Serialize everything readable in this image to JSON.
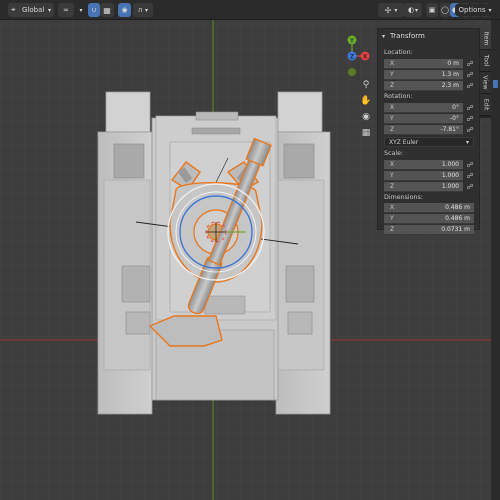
{
  "header": {
    "orientation_label": "Global",
    "options_label": "Options"
  },
  "npanel": {
    "section_title": "Transform",
    "location": {
      "label": "Location:",
      "x": "0 m",
      "y": "1.3 m",
      "z": "2.3 m"
    },
    "rotation": {
      "label": "Rotation:",
      "x": "0°",
      "y": "-0°",
      "z": "-7.81°"
    },
    "rotation_mode": "XYZ Euler",
    "scale": {
      "label": "Scale:",
      "x": "1.000",
      "y": "1.000",
      "z": "1.000"
    },
    "dimensions": {
      "label": "Dimensions:",
      "x": "0.486 m",
      "y": "0.486 m",
      "z": "0.0731 m"
    },
    "axis_labels": {
      "x": "X",
      "y": "Y",
      "z": "Z"
    }
  },
  "side_tabs": [
    "Item",
    "Tool",
    "View",
    "Edit"
  ],
  "gizmo": {
    "x": "X",
    "y": "Y",
    "z": "Z"
  },
  "colors": {
    "selection_outline": "#e8771d",
    "x_axis_line": "#9a3535",
    "y_axis_line": "#5f8a22",
    "accent": "#4772b3",
    "gizmo_x": "#d9423f",
    "gizmo_y": "#6aa82e",
    "gizmo_z": "#3f78d9"
  },
  "icons": [
    "search-icon",
    "hand-icon",
    "camera-icon",
    "grid-icon",
    "lock-icon"
  ]
}
